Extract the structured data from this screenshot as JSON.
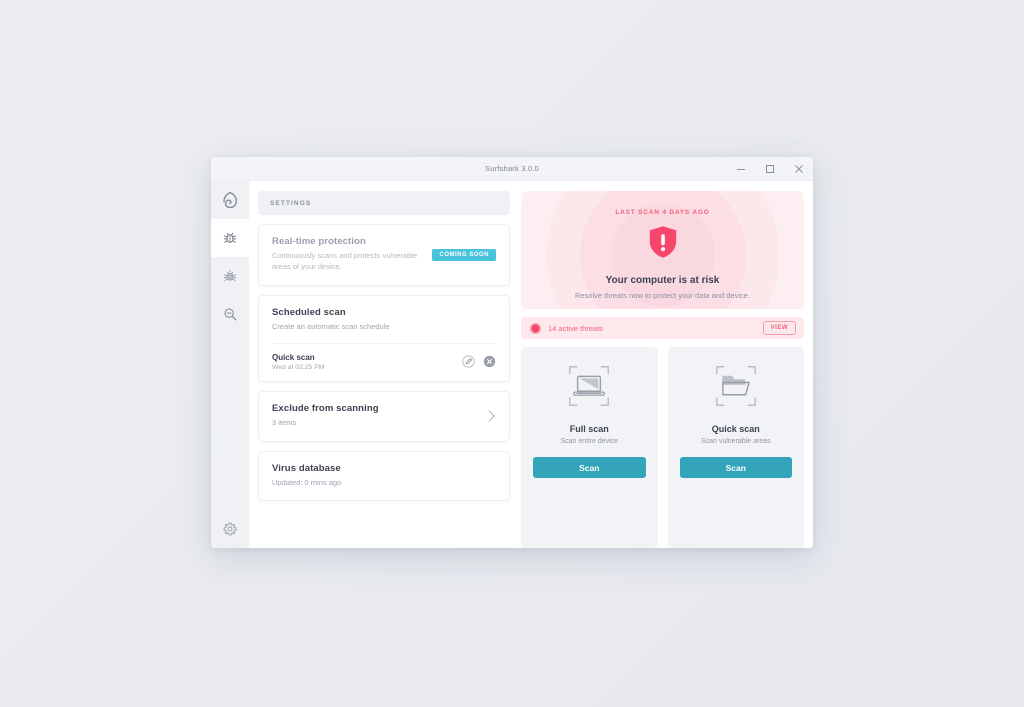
{
  "window": {
    "title": "Surfshark 3.0.0",
    "controls": {
      "minimize": "minimize-icon",
      "maximize": "maximize-icon",
      "close": "close-icon"
    }
  },
  "sidebar": {
    "items": [
      {
        "icon": "surfshark-logo-icon",
        "name": "logo",
        "active": false
      },
      {
        "icon": "bug-icon",
        "name": "antivirus",
        "active": true
      },
      {
        "icon": "alert-bug-icon",
        "name": "alerts",
        "active": false
      },
      {
        "icon": "search-icon",
        "name": "search",
        "active": false
      }
    ],
    "bottom": {
      "icon": "gear-icon",
      "name": "settings"
    }
  },
  "settings": {
    "header": "SETTINGS",
    "realtime": {
      "title": "Real-time protection",
      "subtitle": "Continuously scans and protects vulnerable areas of your device.",
      "badge": "COMING SOON",
      "badge_color": "#49c3dd"
    },
    "scheduled": {
      "title": "Scheduled scan",
      "subtitle": "Create an automatic scan schedule",
      "entries": [
        {
          "name": "Quick scan",
          "time": "Wed at 02:25 PM"
        }
      ],
      "edit_icon": "edit-pencil-icon",
      "delete_icon": "remove-circle-icon"
    },
    "exclude": {
      "title": "Exclude from scanning",
      "subtitle": "3 items",
      "chevron": "chevron-right-icon"
    },
    "virus_db": {
      "title": "Virus database",
      "subtitle": "Updated: 0 mins ago"
    }
  },
  "status": {
    "last_scan": "LAST SCAN 4 DAYS AGO",
    "icon": "shield-alert-icon",
    "title": "Your computer is at risk",
    "subtitle": "Resolve threats now to protect your data and device.",
    "accent_color": "#f4607a"
  },
  "threats": {
    "count_label": "14 active threats",
    "count": 14,
    "button": "VIEW",
    "dot_icon": "pulse-dot-icon"
  },
  "scan_cards": [
    {
      "icon": "laptop-scan-icon",
      "title": "Full scan",
      "subtitle": "Scan entire device",
      "button": "Scan"
    },
    {
      "icon": "folder-scan-icon",
      "title": "Quick scan",
      "subtitle": "Scan vulnerable areas",
      "button": "Scan"
    }
  ],
  "theme": {
    "teal": "#33a4b9",
    "pink": "#f4607a",
    "sidebar_bg": "#f0f1f5"
  }
}
